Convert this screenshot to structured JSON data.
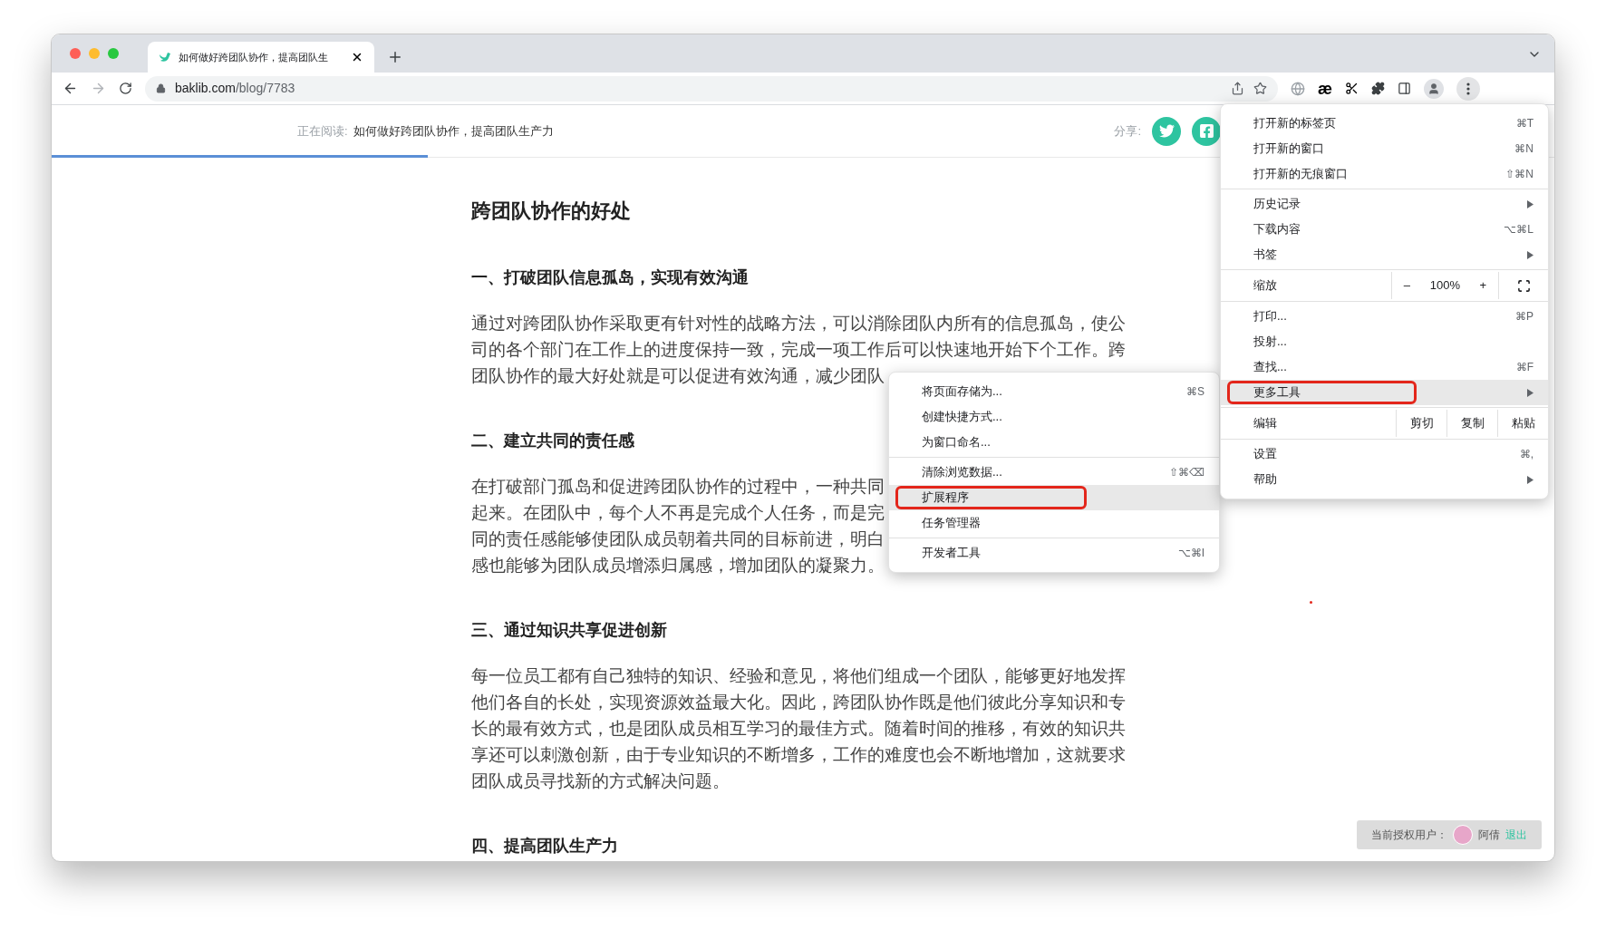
{
  "tab": {
    "title": "如何做好跨团队协作，提高团队生"
  },
  "address_bar": {
    "host": "baklib.com",
    "path": "/blog/7783"
  },
  "extension_glyph": "æ",
  "reading_bar": {
    "label": "正在阅读:",
    "title": "如何做好跨团队协作，提高团队生产力",
    "share_label": "分享:",
    "level": 0.25
  },
  "article": {
    "title": "跨团队协作的好处",
    "sections": [
      {
        "heading": "一、打破团队信息孤岛，实现有效沟通",
        "lines": [
          "通过对跨团队协作采取更有针对性的战略方法，可以消除团队内所有的信息孤岛，使公",
          "司的各个部门在工作上的进度保持一致，完成一项工作后可以快速地开始下个工作。跨",
          "团队协作的最大好处就是可以促进有效沟通，减少团队"
        ]
      },
      {
        "heading": "二、建立共同的责任感",
        "lines": [
          "在打破部门孤岛和促进跨团队协作的过程中，一种共同",
          "起来。在团队中，每个人不再是完成个人任务，而是完",
          "同的责任感能够使团队成员朝着共同的目标前进，明白",
          "感也能够为团队成员增添归属感，增加团队的凝聚力。"
        ]
      },
      {
        "heading": "三、通过知识共享促进创新",
        "lines": [
          "每一位员工都有自己独特的知识、经验和意见，将他们组成一个团队，能够更好地发挥",
          "他们各自的长处，实现资源效益最大化。因此，跨团队协作既是他们彼此分享知识和专",
          "长的最有效方式，也是团队成员相互学习的最佳方式。随着时间的推移，有效的知识共",
          "享还可以刺激创新，由于专业知识的不断增多，工作的难度也会不断地增加，这就要求",
          "团队成员寻找新的方式解决问题。"
        ]
      },
      {
        "heading": "四、提高团队生产力"
      }
    ]
  },
  "menu": {
    "items": [
      {
        "kind": "item",
        "label": "打开新的标签页",
        "shortcut": "⌘T",
        "submenu": false,
        "selected": false,
        "highlight_box": false
      },
      {
        "kind": "item",
        "label": "打开新的窗口",
        "shortcut": "⌘N",
        "submenu": false,
        "selected": false,
        "highlight_box": false
      },
      {
        "kind": "item",
        "label": "打开新的无痕窗口",
        "shortcut": "⇧⌘N",
        "submenu": false,
        "selected": false,
        "highlight_box": false
      },
      {
        "kind": "separator"
      },
      {
        "kind": "item",
        "label": "历史记录",
        "submenu": true,
        "selected": false,
        "highlight_box": false
      },
      {
        "kind": "item",
        "label": "下载内容",
        "shortcut": "⌥⌘L",
        "submenu": false,
        "selected": false,
        "highlight_box": false
      },
      {
        "kind": "item",
        "label": "书签",
        "submenu": true,
        "selected": false,
        "highlight_box": false
      },
      {
        "kind": "separator"
      },
      {
        "kind": "zoom",
        "label": "缩放",
        "minus": "–",
        "value": "100%",
        "plus": "+"
      },
      {
        "kind": "separator"
      },
      {
        "kind": "item",
        "label": "打印...",
        "shortcut": "⌘P",
        "submenu": false,
        "selected": false,
        "highlight_box": false
      },
      {
        "kind": "item",
        "label": "投射...",
        "submenu": false,
        "selected": false,
        "highlight_box": false
      },
      {
        "kind": "item",
        "label": "查找...",
        "shortcut": "⌘F",
        "submenu": false,
        "selected": false,
        "highlight_box": false
      },
      {
        "kind": "item",
        "label": "更多工具",
        "submenu": true,
        "selected": true,
        "highlight_box": true
      },
      {
        "kind": "separator"
      },
      {
        "kind": "edit",
        "label": "编辑",
        "actions": [
          "剪切",
          "复制",
          "粘贴"
        ]
      },
      {
        "kind": "separator"
      },
      {
        "kind": "item",
        "label": "设置",
        "shortcut": "⌘,",
        "submenu": false,
        "selected": false,
        "highlight_box": false
      },
      {
        "kind": "item",
        "label": "帮助",
        "submenu": true,
        "selected": false,
        "highlight_box": false
      }
    ]
  },
  "submenu": {
    "items": [
      {
        "kind": "item",
        "label": "将页面存储为...",
        "shortcut": "⌘S",
        "submenu": false,
        "selected": false,
        "highlight_box": false
      },
      {
        "kind": "item",
        "label": "创建快捷方式...",
        "submenu": false,
        "selected": false,
        "highlight_box": false
      },
      {
        "kind": "item",
        "label": "为窗口命名...",
        "submenu": false,
        "selected": false,
        "highlight_box": false
      },
      {
        "kind": "separator"
      },
      {
        "kind": "item",
        "label": "清除浏览数据...",
        "shortcut": "⇧⌘⌫",
        "submenu": false,
        "selected": false,
        "highlight_box": false
      },
      {
        "kind": "item",
        "label": "扩展程序",
        "submenu": false,
        "selected": true,
        "highlight_box": true
      },
      {
        "kind": "item",
        "label": "任务管理器",
        "submenu": false,
        "selected": false,
        "highlight_box": false
      },
      {
        "kind": "separator"
      },
      {
        "kind": "item",
        "label": "开发者工具",
        "shortcut": "⌥⌘I",
        "submenu": false,
        "selected": false,
        "highlight_box": false
      }
    ]
  },
  "user_badge": {
    "label": "当前授权用户：",
    "name": "阿倩",
    "logout": "退出"
  }
}
